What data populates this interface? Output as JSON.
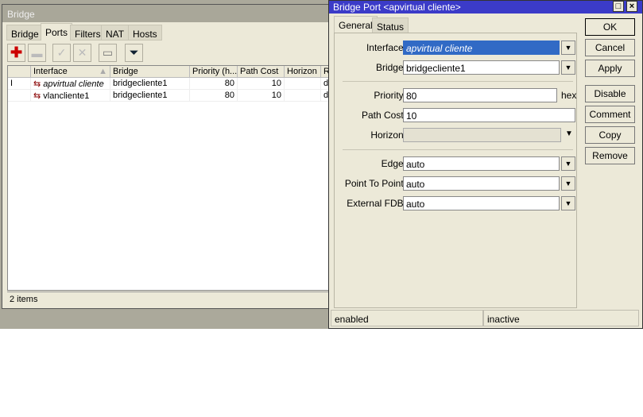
{
  "bridge_window": {
    "title": "Bridge",
    "tabs": [
      "Bridge",
      "Ports",
      "Filters",
      "NAT",
      "Hosts"
    ],
    "active_tab": "Ports",
    "columns": [
      "",
      "Interface",
      "Bridge",
      "Priority (h...",
      "Path Cost",
      "Horizon",
      "R"
    ],
    "rows": [
      {
        "flag": "I",
        "interface": "apvirtual cliente",
        "bridge": "bridgecliente1",
        "priority": "80",
        "path_cost": "10",
        "horizon": "",
        "r": "di"
      },
      {
        "flag": "",
        "interface": "vlancliente1",
        "bridge": "bridgecliente1",
        "priority": "80",
        "path_cost": "10",
        "horizon": "",
        "r": "de"
      }
    ],
    "status": "2 items"
  },
  "dialog": {
    "title": "Bridge Port <apvirtual cliente>",
    "tabs": [
      "General",
      "Status"
    ],
    "fields": {
      "interface_label": "Interface:",
      "interface": "apvirtual cliente",
      "bridge_label": "Bridge:",
      "bridge": "bridgecliente1",
      "priority_label": "Priority:",
      "priority": "80",
      "hex": "hex",
      "path_cost_label": "Path Cost:",
      "path_cost": "10",
      "horizon_label": "Horizon:",
      "horizon": "",
      "edge_label": "Edge:",
      "edge": "auto",
      "p2p_label": "Point To Point:",
      "p2p": "auto",
      "fdb_label": "External FDB:",
      "fdb": "auto"
    },
    "buttons": [
      "OK",
      "Cancel",
      "Apply",
      "Disable",
      "Comment",
      "Copy",
      "Remove"
    ],
    "status_left": "enabled",
    "status_right": "inactive"
  }
}
